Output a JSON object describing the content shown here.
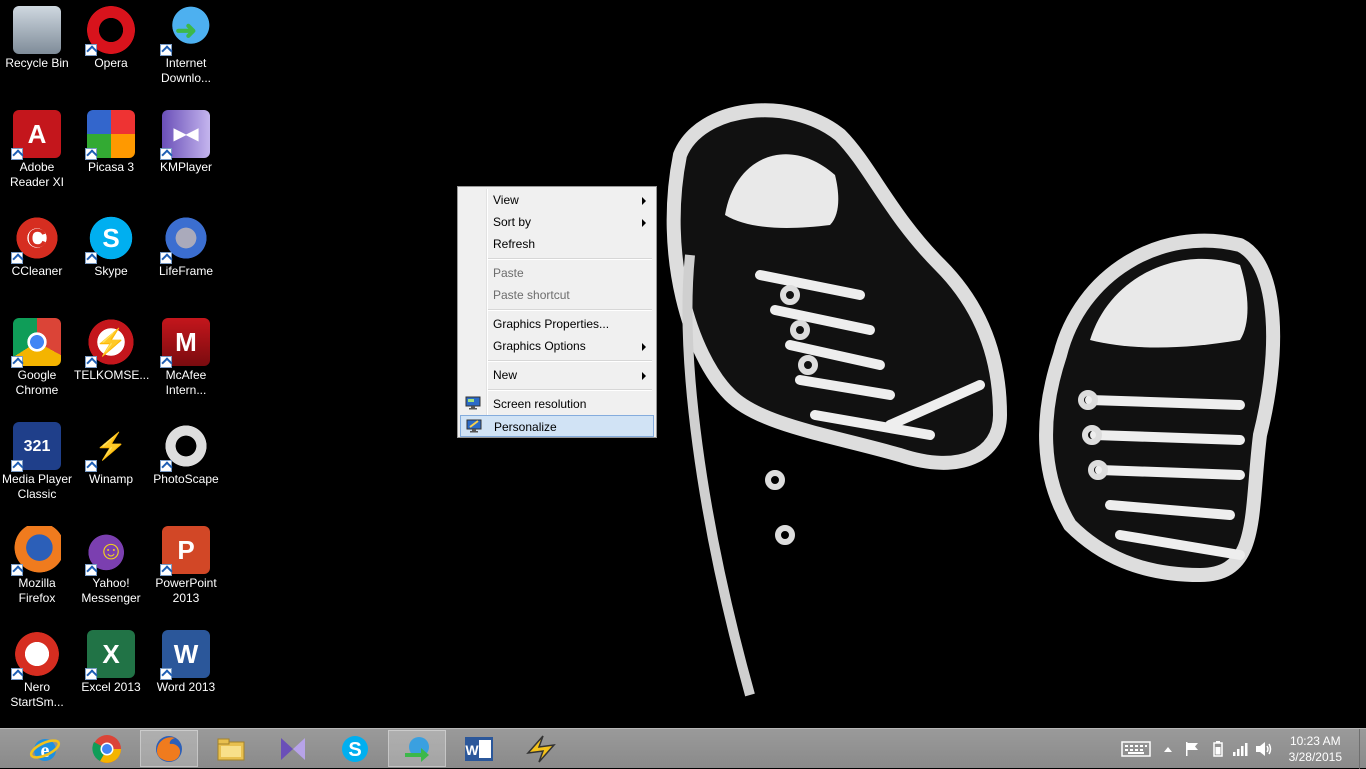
{
  "desktop": {
    "icons": [
      {
        "label": "Recycle Bin",
        "icon": "recycle-bin-icon"
      },
      {
        "label": "Opera",
        "icon": "opera-icon"
      },
      {
        "label": "Internet Downlo...",
        "icon": "internet-download-manager-icon"
      },
      {
        "label": "Adobe Reader XI",
        "icon": "adobe-reader-icon"
      },
      {
        "label": "Picasa 3",
        "icon": "picasa-icon"
      },
      {
        "label": "KMPlayer",
        "icon": "kmplayer-icon"
      },
      {
        "label": "CCleaner",
        "icon": "ccleaner-icon"
      },
      {
        "label": "Skype",
        "icon": "skype-icon"
      },
      {
        "label": "LifeFrame",
        "icon": "lifeframe-icon"
      },
      {
        "label": "Google Chrome",
        "icon": "chrome-icon"
      },
      {
        "label": "TELKOMSE...",
        "icon": "telkomsel-icon"
      },
      {
        "label": "McAfee Intern...",
        "icon": "mcafee-icon"
      },
      {
        "label": "Media Player Classic",
        "icon": "media-player-classic-icon"
      },
      {
        "label": "Winamp",
        "icon": "winamp-icon"
      },
      {
        "label": "PhotoScape",
        "icon": "photoscape-icon"
      },
      {
        "label": "Mozilla Firefox",
        "icon": "firefox-icon"
      },
      {
        "label": "Yahoo! Messenger",
        "icon": "yahoo-messenger-icon"
      },
      {
        "label": "PowerPoint 2013",
        "icon": "powerpoint-icon"
      },
      {
        "label": "Nero StartSm...",
        "icon": "nero-icon"
      },
      {
        "label": "Excel 2013",
        "icon": "excel-icon"
      },
      {
        "label": "Word 2013",
        "icon": "word-icon"
      }
    ]
  },
  "context_menu": {
    "view": "View",
    "sort_by": "Sort by",
    "refresh": "Refresh",
    "paste": "Paste",
    "paste_shortcut": "Paste shortcut",
    "graphics_properties": "Graphics Properties...",
    "graphics_options": "Graphics Options",
    "new": "New",
    "screen_resolution": "Screen resolution",
    "personalize": "Personalize",
    "highlighted": "Personalize"
  },
  "taskbar": {
    "pinned": [
      "internet-explorer-icon",
      "chrome-icon",
      "firefox-icon",
      "file-explorer-icon",
      "kmplayer-icon",
      "skype-icon",
      "internet-download-manager-icon",
      "word-icon",
      "winamp-icon"
    ],
    "active": "firefox-icon",
    "clock": {
      "time": "10:23 AM",
      "date": "3/28/2015"
    }
  },
  "colors": {
    "desktop_bg": "#000000",
    "taskbar_bg": "#8f8f8f",
    "menu_bg": "#f0f0f0",
    "menu_highlight": "#d1e3f5"
  }
}
